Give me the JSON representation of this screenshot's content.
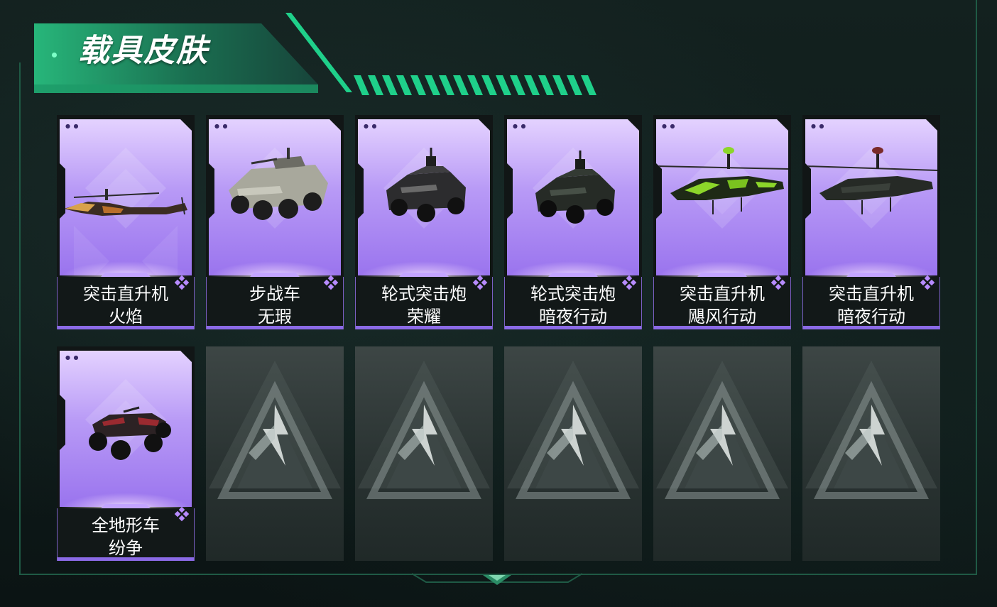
{
  "section": {
    "title": "载具皮肤"
  },
  "colors": {
    "accent_green": "#1fd08a",
    "card_purple": "#a884f2",
    "rarity_purple": "#b78bff"
  },
  "skins": [
    {
      "line1": "突击直升机",
      "line2": "火焰",
      "vehicle": "helicopter-flame-icon",
      "rarity": "purple"
    },
    {
      "line1": "步战车",
      "line2": "无瑕",
      "vehicle": "ifv-icon",
      "rarity": "purple"
    },
    {
      "line1": "轮式突击炮",
      "line2": "荣耀",
      "vehicle": "armored-car-glory-icon",
      "rarity": "purple"
    },
    {
      "line1": "轮式突击炮",
      "line2": "暗夜行动",
      "vehicle": "armored-car-night-icon",
      "rarity": "purple"
    },
    {
      "line1": "突击直升机",
      "line2": "飓风行动",
      "vehicle": "helicopter-hurricane-icon",
      "rarity": "purple"
    },
    {
      "line1": "突击直升机",
      "line2": "暗夜行动",
      "vehicle": "helicopter-night-icon",
      "rarity": "purple"
    },
    {
      "line1": "全地形车",
      "line2": "纷争",
      "vehicle": "atv-icon",
      "rarity": "purple"
    }
  ],
  "empty_slots": 5,
  "empty_slot_icon": "locked-logo-icon"
}
